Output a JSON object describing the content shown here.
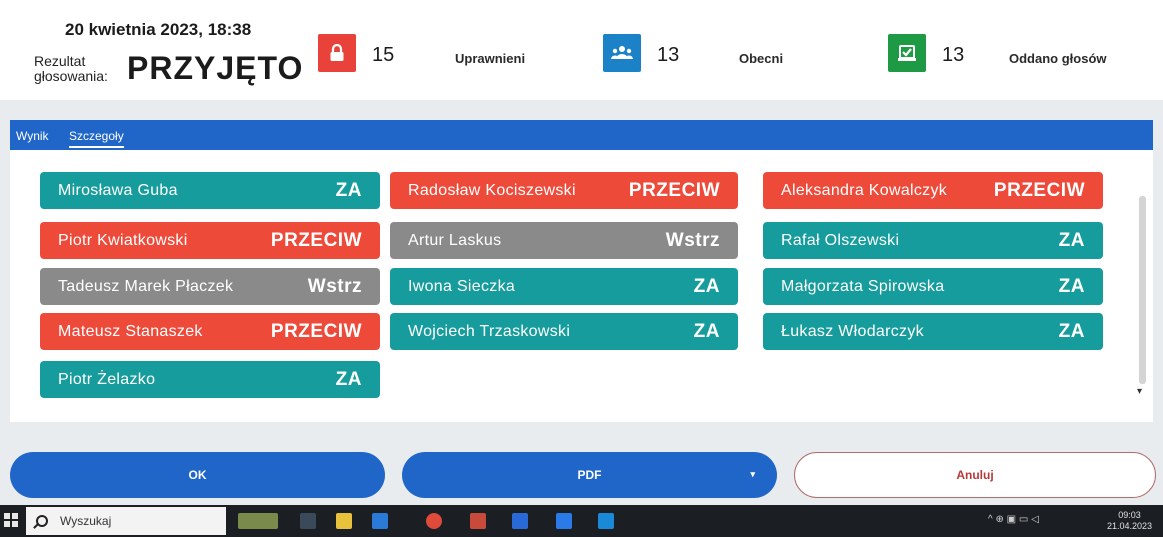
{
  "header": {
    "date": "20 kwietnia 2023, 18:38",
    "result_label": "Rezultat głosowania:",
    "result_value": "PRZYJĘTO",
    "stats": [
      {
        "icon": "lock-icon",
        "count": "15",
        "label": "Uprawnieni",
        "color": "#e8423a"
      },
      {
        "icon": "users-icon",
        "count": "13",
        "label": "Obecni",
        "color": "#1c82c8"
      },
      {
        "icon": "ballot-check-icon",
        "count": "13",
        "label": "Oddano głosów",
        "color": "#1e9a45"
      }
    ]
  },
  "tabs": [
    {
      "label": "Wynik"
    },
    {
      "label": "Szczegoły"
    }
  ],
  "colors": {
    "ZA": "#169c9c",
    "PRZECIW": "#ee4a3a",
    "Wstrz": "#8a8a8a",
    "accent": "#1f66c8"
  },
  "votes": [
    {
      "name": "Mirosława Guba",
      "vote": "ZA"
    },
    {
      "name": "Radosław Kociszewski",
      "vote": "PRZECIW"
    },
    {
      "name": "Aleksandra Kowalczyk",
      "vote": "PRZECIW"
    },
    {
      "name": "Piotr Kwiatkowski",
      "vote": "PRZECIW"
    },
    {
      "name": "Artur Laskus",
      "vote": "Wstrz"
    },
    {
      "name": "Rafał Olszewski",
      "vote": "ZA"
    },
    {
      "name": "Tadeusz Marek Płaczek",
      "vote": "Wstrz"
    },
    {
      "name": "Iwona Sieczka",
      "vote": "ZA"
    },
    {
      "name": "Małgorzata Spirowska",
      "vote": "ZA"
    },
    {
      "name": "Mateusz Stanaszek",
      "vote": "PRZECIW"
    },
    {
      "name": "Wojciech Trzaskowski",
      "vote": "ZA"
    },
    {
      "name": "Łukasz Włodarczyk",
      "vote": "ZA"
    },
    {
      "name": "Piotr Żelazko",
      "vote": "ZA"
    }
  ],
  "buttons": {
    "ok": "OK",
    "pdf": "PDF",
    "cancel": "Anuluj"
  },
  "taskbar": {
    "search_placeholder": "Wyszukaj",
    "time": "09:03",
    "date": "21.04.2023"
  }
}
